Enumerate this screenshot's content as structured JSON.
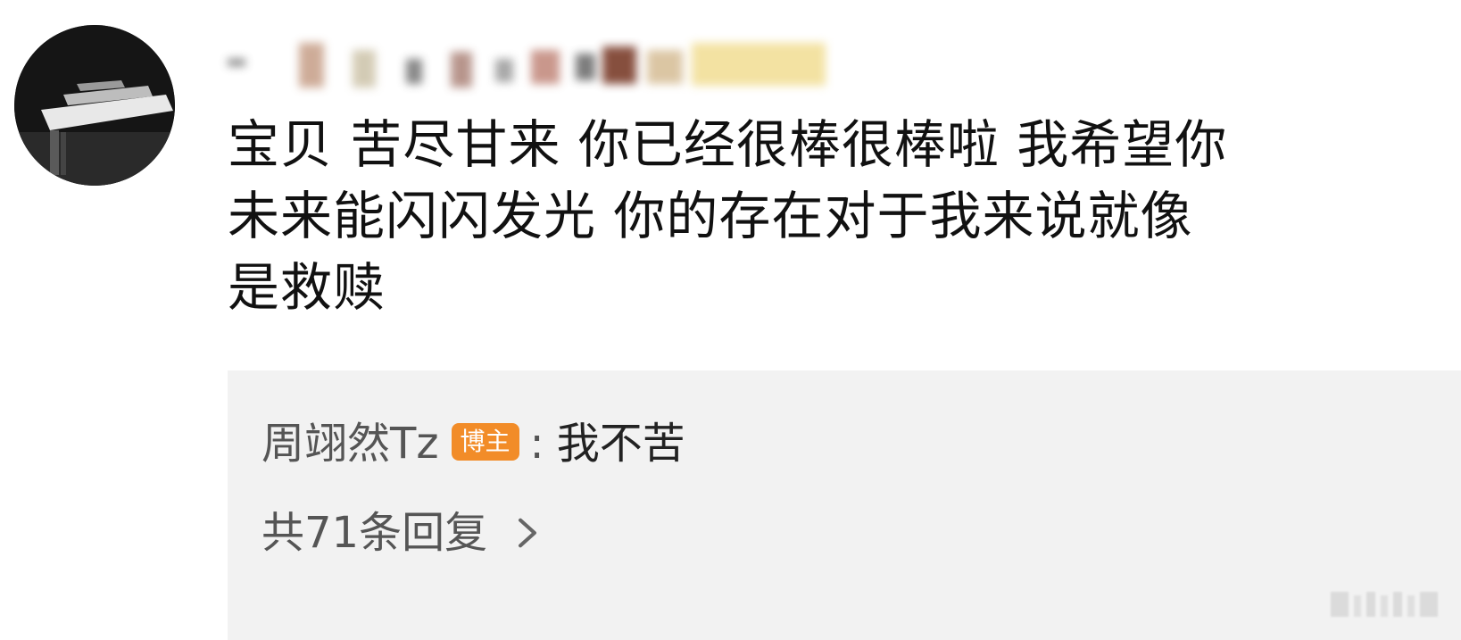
{
  "comment": {
    "text": "宝贝 苦尽甘来 你已经很棒很棒啦 我希望你\n未来能闪闪发光 你的存在对于我来说就像\n是救赎"
  },
  "reply": {
    "author": "周翊然Tz",
    "badge": "博主",
    "colon": ":",
    "text": "我不苦",
    "count_label": "共71条回复"
  },
  "icons": {
    "avatar": "avatar-image",
    "chevron": "chevron-right-icon",
    "watermark": "watermark-logo"
  },
  "colors": {
    "reply_background": "#f2f2f2",
    "badge_background": "#f28c28",
    "secondary_text": "#555555",
    "primary_text": "#111111"
  }
}
